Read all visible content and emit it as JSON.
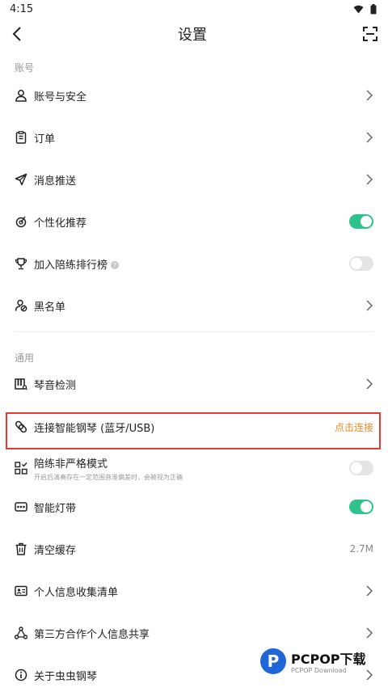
{
  "status": {
    "time": "4:15"
  },
  "header": {
    "title": "设置",
    "back_icon": "chevron-left-icon",
    "scan_icon": "scan-icon"
  },
  "sections": {
    "account": {
      "title": "账号",
      "items": {
        "account_security": "账号与安全",
        "orders": "订单",
        "push": "消息推送",
        "personal_recommend": "个性化推荐",
        "ranking": "加入陪练排行榜",
        "blacklist": "黑名单"
      },
      "toggles": {
        "personal_recommend": "on",
        "ranking": "off"
      }
    },
    "general": {
      "title": "通用",
      "items": {
        "pitch_test": "琴音检测",
        "connect_piano": "连接智能钢琴 (蓝牙/USB)",
        "connect_action": "点击连接",
        "loose_mode": "陪练非严格模式",
        "loose_mode_desc": "开启后演奏存在一定范围音准偏差时，会被视为正确",
        "light_strip": "智能灯带",
        "clear_cache": "清空缓存",
        "cache_size": "2.7M",
        "info_collect": "个人信息收集清单",
        "third_party": "第三方合作个人信息共享",
        "about": "关于虫虫钢琴"
      },
      "toggles": {
        "loose_mode": "off",
        "light_strip": "on"
      }
    }
  },
  "watermark": {
    "letter": "P",
    "text": "PCPOP下载",
    "sub": "PCPOP Download"
  },
  "colors": {
    "accent_green": "#2ec38a",
    "accent_orange": "#f08a24",
    "highlight_red": "#e53935"
  }
}
